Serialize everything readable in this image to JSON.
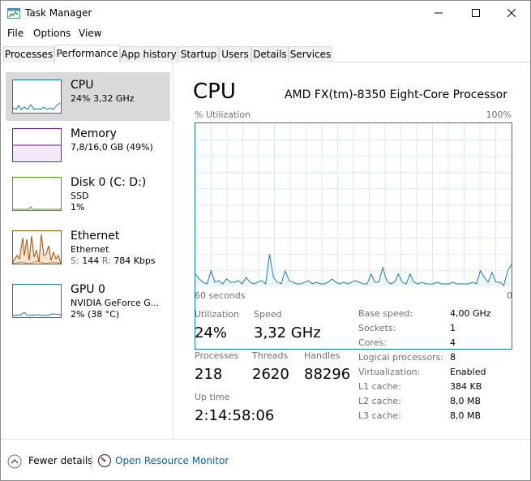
{
  "window": {
    "title": "Task Manager"
  },
  "menu": {
    "file": "File",
    "options": "Options",
    "view": "View"
  },
  "tabs": [
    "Processes",
    "Performance",
    "App history",
    "Startup",
    "Users",
    "Details",
    "Services"
  ],
  "active_tab": "Performance",
  "resources": [
    {
      "name": "CPU",
      "line1": "24% 3,32 GHz",
      "line2": "",
      "color": "#117dbb",
      "selected": true
    },
    {
      "name": "Memory",
      "line1": "7,8/16,0 GB (49%)",
      "line2": "",
      "color": "#8b12ae",
      "selected": false
    },
    {
      "name": "Disk 0 (C: D:)",
      "line1": "SSD",
      "line2": "1%",
      "color": "#4da60c",
      "selected": false
    },
    {
      "name": "Ethernet",
      "line1": "Ethernet",
      "line2_label_s": "S:",
      "line2_s": "144",
      "line2_label_r": "R:",
      "line2_r": "784 Kbps",
      "color": "#a74f01",
      "selected": false
    },
    {
      "name": "GPU 0",
      "line1": "NVIDIA GeForce G...",
      "line2": "2% (38 °C)",
      "color": "#117dbb",
      "selected": false
    }
  ],
  "main": {
    "title": "CPU",
    "model": "AMD FX(tm)-8350 Eight-Core Processor",
    "util_label": "% Utilization",
    "util_max": "100%",
    "time_label": "60 seconds",
    "time_end": "0",
    "stats": {
      "utilization_label": "Utilization",
      "utilization": "24%",
      "speed_label": "Speed",
      "speed": "3,32 GHz",
      "processes_label": "Processes",
      "processes": "218",
      "threads_label": "Threads",
      "threads": "2620",
      "handles_label": "Handles",
      "handles": "88296",
      "uptime_label": "Up time",
      "uptime": "2:14:58:06"
    },
    "details": [
      {
        "label": "Base speed:",
        "value": "4,00 GHz"
      },
      {
        "label": "Sockets:",
        "value": "1"
      },
      {
        "label": "Cores:",
        "value": "4"
      },
      {
        "label": "Logical processors:",
        "value": "8"
      },
      {
        "label": "Virtualization:",
        "value": "Enabled"
      },
      {
        "label": "L1 cache:",
        "value": "384 KB"
      },
      {
        "label": "L2 cache:",
        "value": "8,0 MB"
      },
      {
        "label": "L3 cache:",
        "value": "8,0 MB"
      }
    ],
    "graph_series": [
      8,
      5,
      3,
      2,
      10,
      3,
      4,
      2,
      5,
      3,
      3,
      4,
      2,
      6,
      3,
      2,
      3,
      4,
      2,
      20,
      6,
      3,
      2,
      10,
      4,
      3,
      2,
      2,
      3,
      4,
      2,
      3,
      2,
      2,
      3,
      5,
      3,
      2,
      3,
      2,
      3,
      4,
      3,
      2,
      2,
      8,
      3,
      3,
      12,
      4,
      2,
      3,
      8,
      3,
      2,
      8,
      3,
      2,
      3,
      2,
      2,
      2,
      3,
      2,
      2,
      2,
      3,
      2,
      2,
      2,
      2,
      3,
      2,
      10,
      6,
      3,
      9,
      3,
      3,
      1,
      10,
      14
    ]
  },
  "bottom": {
    "fewer_details": "Fewer details",
    "open_resource_monitor": "Open Resource Monitor"
  },
  "colors": {
    "cpu_line": "#117dbb",
    "cpu_fill": "#f1f6fa",
    "grid": "#d9eaf4"
  }
}
